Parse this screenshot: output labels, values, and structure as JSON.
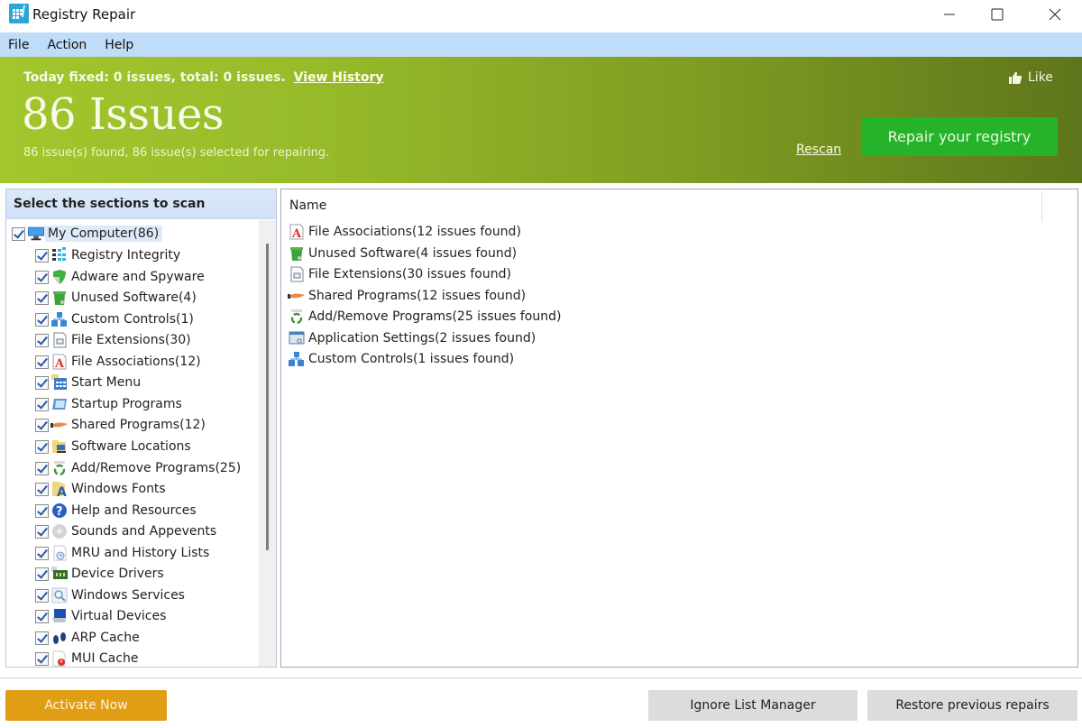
{
  "window": {
    "title": "Registry Repair",
    "controls": {
      "minimize": "minimize",
      "maximize": "maximize",
      "close": "close"
    }
  },
  "menu": [
    "File",
    "Action",
    "Help"
  ],
  "header": {
    "today_text": "Today fixed: 0 issues, total: 0 issues.",
    "view_history": "View History",
    "issues_title": "86 Issues",
    "issues_subtitle": "86 issue(s) found, 86 issue(s) selected for repairing.",
    "like_label": "Like",
    "rescan_label": "Rescan",
    "repair_button": "Repair your registry",
    "colors": {
      "gradient_start": "#a3c62d",
      "gradient_end": "#5f751b",
      "repair_button": "#25b32a"
    }
  },
  "scan_sections": {
    "heading": "Select the sections to scan",
    "root": {
      "label": "My Computer(86)",
      "icon": "computer-icon",
      "checked": true
    },
    "items": [
      {
        "label": "Registry Integrity",
        "icon": "registry-integrity-icon",
        "checked": true
      },
      {
        "label": "Adware and Spyware",
        "icon": "shield-icon",
        "checked": true
      },
      {
        "label": "Unused Software(4)",
        "icon": "trash-bin-icon",
        "checked": true
      },
      {
        "label": "Custom Controls(1)",
        "icon": "blocks-icon",
        "checked": true
      },
      {
        "label": "File Extensions(30)",
        "icon": "file-extension-icon",
        "checked": true
      },
      {
        "label": "File Associations(12)",
        "icon": "file-association-icon",
        "checked": true
      },
      {
        "label": "Start Menu",
        "icon": "start-menu-icon",
        "checked": true
      },
      {
        "label": "Startup Programs",
        "icon": "startup-icon",
        "checked": true
      },
      {
        "label": "Shared Programs(12)",
        "icon": "handshake-icon",
        "checked": true
      },
      {
        "label": "Software Locations",
        "icon": "folder-computer-icon",
        "checked": true
      },
      {
        "label": "Add/Remove Programs(25)",
        "icon": "recycle-icon",
        "checked": true
      },
      {
        "label": "Windows Fonts",
        "icon": "font-folder-icon",
        "checked": true
      },
      {
        "label": "Help and Resources",
        "icon": "help-icon",
        "checked": true
      },
      {
        "label": "Sounds and Appevents",
        "icon": "sound-icon",
        "checked": true
      },
      {
        "label": "MRU and History Lists",
        "icon": "history-icon",
        "checked": true
      },
      {
        "label": "Device Drivers",
        "icon": "device-driver-icon",
        "checked": true
      },
      {
        "label": "Windows Services",
        "icon": "services-icon",
        "checked": true
      },
      {
        "label": "Virtual Devices",
        "icon": "virtual-device-icon",
        "checked": true
      },
      {
        "label": "ARP Cache",
        "icon": "footprints-icon",
        "checked": true
      },
      {
        "label": "MUI Cache",
        "icon": "mui-cache-icon",
        "checked": true
      }
    ]
  },
  "results": {
    "column_name": "Name",
    "rows": [
      {
        "label": "File Associations(12 issues found)",
        "icon": "file-association-icon"
      },
      {
        "label": "Unused Software(4 issues found)",
        "icon": "trash-bin-icon"
      },
      {
        "label": "File Extensions(30 issues found)",
        "icon": "file-extension-icon"
      },
      {
        "label": "Shared Programs(12 issues found)",
        "icon": "handshake-icon"
      },
      {
        "label": "Add/Remove Programs(25 issues found)",
        "icon": "recycle-icon"
      },
      {
        "label": "Application Settings(2 issues found)",
        "icon": "app-settings-icon"
      },
      {
        "label": "Custom Controls(1 issues found)",
        "icon": "blocks-icon"
      }
    ]
  },
  "footer": {
    "activate": "Activate Now",
    "ignore_list": "Ignore List Manager",
    "restore": "Restore previous repairs",
    "colors": {
      "activate": "#e19e14",
      "secondary": "#dcdcdc"
    }
  }
}
